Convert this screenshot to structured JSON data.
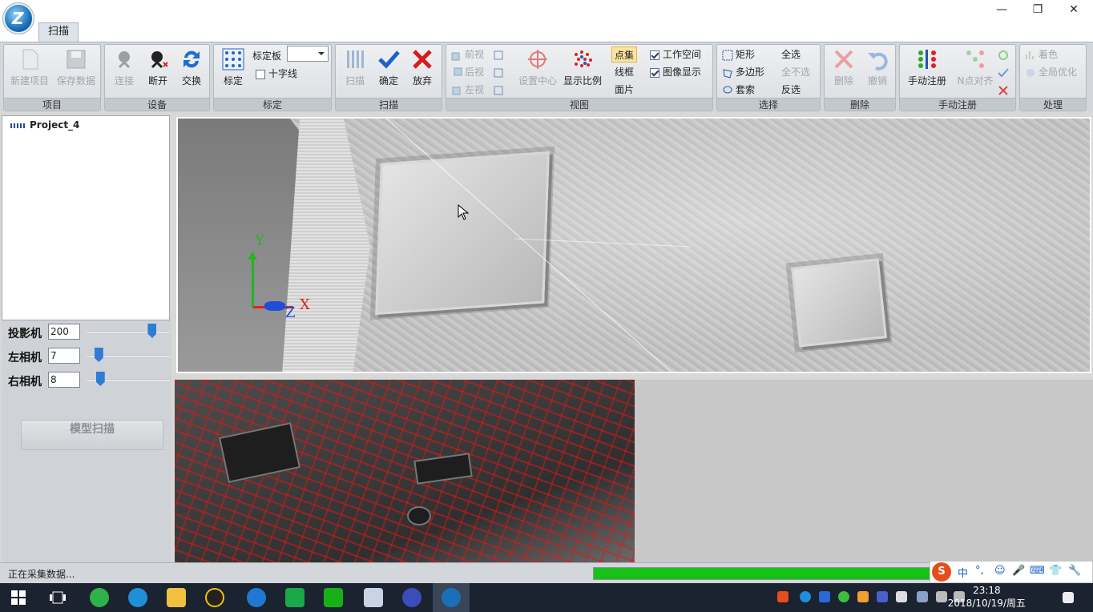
{
  "window": {
    "logo_text": "Z",
    "minimize": "—",
    "maximize": "❐",
    "close": "✕"
  },
  "ribbon": {
    "tab": "扫描",
    "groups": {
      "project": {
        "caption": "项目",
        "new": "新建项目",
        "save": "保存数据"
      },
      "device": {
        "caption": "设备",
        "connect": "连接",
        "disconnect": "断开",
        "switch": "交换"
      },
      "calibration": {
        "caption": "标定",
        "calibrate": "标定",
        "board_label": "标定板",
        "crosshair": "十字线"
      },
      "scan": {
        "caption": "扫描",
        "scan": "扫描",
        "confirm": "确定",
        "abandon": "放弃"
      },
      "view": {
        "caption": "视图",
        "front": "前视",
        "back": "后视",
        "left": "左视",
        "set_center": "设置中心",
        "scale": "显示比例",
        "point_set": "点集",
        "wireframe": "线框",
        "surface": "面片",
        "workspace": "工作空间",
        "image_display": "图像显示"
      },
      "select": {
        "caption": "选择",
        "rect": "矩形",
        "polygon": "多边形",
        "lasso": "套索",
        "select_all": "全选",
        "select_none": "全不选",
        "invert": "反选"
      },
      "delete": {
        "caption": "删除",
        "delete": "删除",
        "undo": "撤销"
      },
      "manual_reg": {
        "caption": "手动注册",
        "manual": "手动注册",
        "n_point": "N点对齐"
      },
      "process": {
        "caption": "处理",
        "color": "着色",
        "global_opt": "全局优化"
      }
    }
  },
  "tree": {
    "project": "Project_4"
  },
  "controls": {
    "projector": {
      "label": "投影机",
      "value": "200",
      "level": 0.78
    },
    "left_cam": {
      "label": "左相机",
      "value": "7",
      "level": 0.1
    },
    "right_cam": {
      "label": "右相机",
      "value": "8",
      "level": 0.12
    },
    "model_scan": "模型扫描"
  },
  "viewport": {
    "axis_x": "X",
    "axis_y": "Y",
    "axis_z": "Z"
  },
  "status": {
    "text": "正在采集数据...",
    "progress": 0.96
  },
  "ime": {
    "items": [
      "中",
      "°,",
      "☺",
      "🎤",
      "⌨",
      "👕",
      "🔧"
    ]
  },
  "clock": {
    "time": "23:18",
    "date": "2018/10/19/周五"
  },
  "colors": {
    "accent": "#2f7bd6",
    "progress": "#17c217",
    "edge_overlay": "#e01414"
  }
}
